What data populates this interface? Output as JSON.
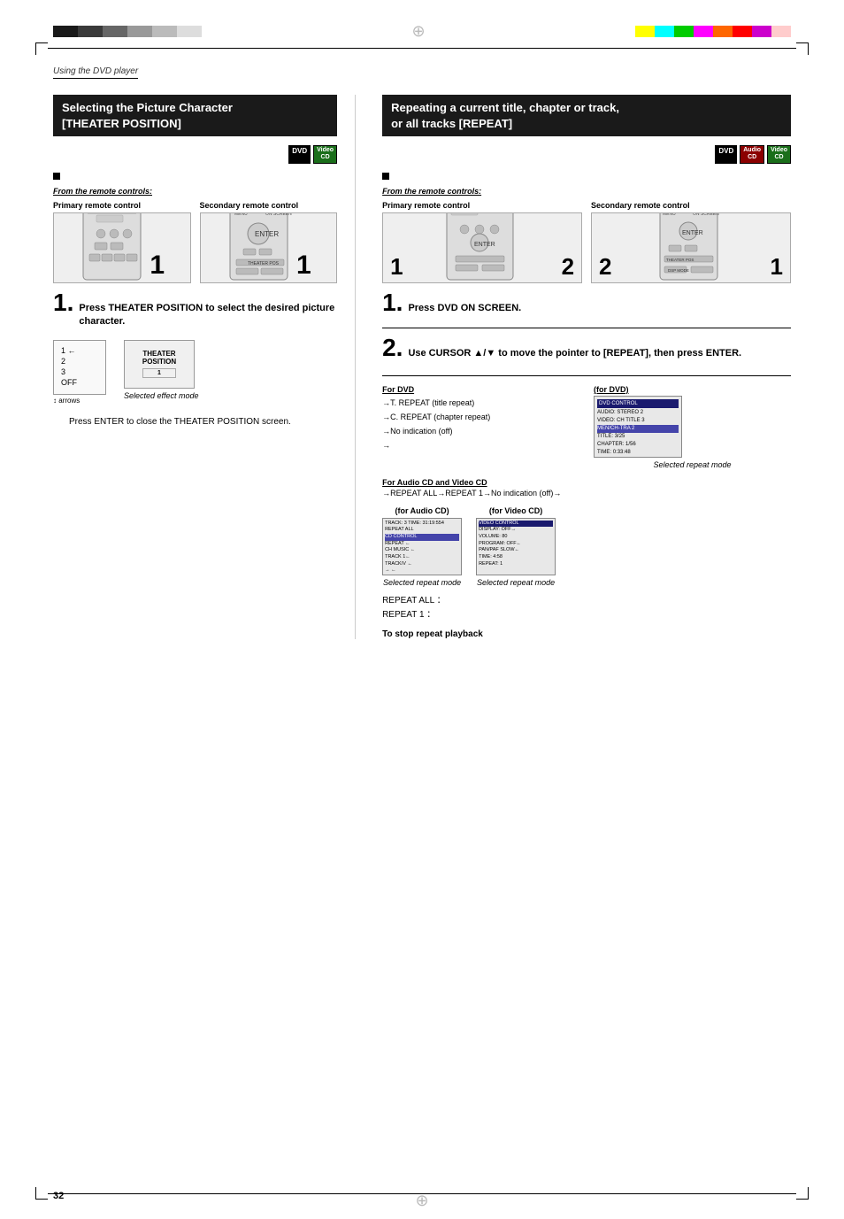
{
  "page": {
    "number": "32",
    "section_label": "Using the DVD player",
    "crosshair_symbol": "⊕"
  },
  "color_bars_left": [
    "#1a1a1a",
    "#3a3a3a",
    "#666",
    "#999",
    "#bbb",
    "#ddd"
  ],
  "color_bars_right": [
    "#ffff00",
    "#00ffff",
    "#00cc00",
    "#ff00ff",
    "#ff6600",
    "#ff0000",
    "#cc00cc",
    "#ffcccc"
  ],
  "left_section": {
    "title_line1": "Selecting the Picture Character",
    "title_line2": "[THEATER POSITION]",
    "badges": [
      "DVD",
      "Video CD"
    ],
    "bullet": "■",
    "from_remote": "From the remote controls:",
    "primary_label": "Primary remote control",
    "secondary_label": "Secondary remote control",
    "remote_number_left": "1",
    "remote_number_right": "1",
    "step1_num": "1.",
    "step1_text": "Press THEATER POSITION to select the desired picture character.",
    "effect_items": [
      "1",
      "2",
      "3",
      "OFF"
    ],
    "effect_caption": "Selected effect mode",
    "screen_label": "THEATER",
    "press_enter_text": "Press ENTER to close the THEATER POSITION screen."
  },
  "right_section": {
    "title_line1": "Repeating a current title, chapter or track,",
    "title_line2": "or all tracks [REPEAT]",
    "badges": [
      "DVD",
      "Audio CD",
      "Video CD"
    ],
    "bullet": "■",
    "from_remote": "From the remote controls:",
    "primary_label": "Primary remote control",
    "secondary_label": "Secondary remote control",
    "remote_number_left_top": "1",
    "remote_number_right_top": "2",
    "remote_number_left_bottom": "2",
    "remote_number_right_bottom": "1",
    "step1_num": "1.",
    "step1_text": "Press DVD ON SCREEN.",
    "step2_num": "2.",
    "step2_text": "Use CURSOR ▲/▼ to move the pointer to [REPEAT], then press ENTER.",
    "for_dvd_label": "For DVD",
    "for_dvd_paren": "(for DVD)",
    "dvd_repeat_flow": [
      "→T. REPEAT (title repeat)",
      "→C. REPEAT (chapter repeat)",
      "→No indication (off)",
      "→"
    ],
    "selected_repeat_mode_dvd": "Selected repeat mode",
    "for_audio_cd_label": "For Audio CD and Video CD",
    "audio_cd_flow": "→REPEAT ALL→REPEAT 1→No indication (off)→",
    "for_audio_cd_paren": "(for Audio CD)",
    "for_video_cd_paren": "(for Video CD)",
    "selected_repeat_mode_audio": "Selected repeat mode",
    "selected_repeat_mode_video": "Selected repeat mode",
    "repeat_all_label": "REPEAT ALL  ：",
    "repeat_1_label": "REPEAT 1      ：",
    "to_stop": "To stop repeat playback"
  }
}
